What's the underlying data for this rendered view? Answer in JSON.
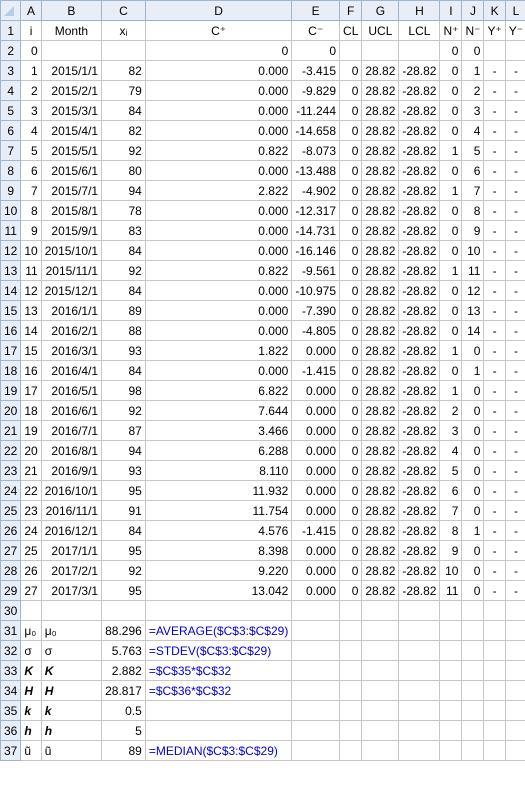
{
  "columns": [
    "A",
    "B",
    "C",
    "D",
    "E",
    "F",
    "G",
    "H",
    "I",
    "J",
    "K",
    "L"
  ],
  "headerRow": {
    "num": "1",
    "cells": {
      "A": "i",
      "B": "Month",
      "C": "xᵢ",
      "D": "C⁺",
      "E": "C⁻",
      "F": "CL",
      "G": "UCL",
      "H": "LCL",
      "I": "N⁺",
      "J": "N⁻",
      "K": "Y⁺",
      "L": "Y⁻"
    }
  },
  "rows": [
    {
      "num": "2",
      "type": "data",
      "cells": {
        "A": "0",
        "D": "0",
        "E": "0",
        "I": "0",
        "J": "0"
      }
    },
    {
      "num": "3",
      "type": "data",
      "cells": {
        "A": "1",
        "B": "2015/1/1",
        "C": "82",
        "D": "0.000",
        "E": "-3.415",
        "F": "0",
        "G": "28.82",
        "H": "-28.82",
        "I": "0",
        "J": "1",
        "K": "-",
        "L": "-"
      }
    },
    {
      "num": "4",
      "type": "data",
      "cells": {
        "A": "2",
        "B": "2015/2/1",
        "C": "79",
        "D": "0.000",
        "E": "-9.829",
        "F": "0",
        "G": "28.82",
        "H": "-28.82",
        "I": "0",
        "J": "2",
        "K": "-",
        "L": "-"
      }
    },
    {
      "num": "5",
      "type": "data",
      "cells": {
        "A": "3",
        "B": "2015/3/1",
        "C": "84",
        "D": "0.000",
        "E": "-11.244",
        "F": "0",
        "G": "28.82",
        "H": "-28.82",
        "I": "0",
        "J": "3",
        "K": "-",
        "L": "-"
      }
    },
    {
      "num": "6",
      "type": "data",
      "cells": {
        "A": "4",
        "B": "2015/4/1",
        "C": "82",
        "D": "0.000",
        "E": "-14.658",
        "F": "0",
        "G": "28.82",
        "H": "-28.82",
        "I": "0",
        "J": "4",
        "K": "-",
        "L": "-"
      }
    },
    {
      "num": "7",
      "type": "data",
      "cells": {
        "A": "5",
        "B": "2015/5/1",
        "C": "92",
        "D": "0.822",
        "E": "-8.073",
        "F": "0",
        "G": "28.82",
        "H": "-28.82",
        "I": "1",
        "J": "5",
        "K": "-",
        "L": "-"
      }
    },
    {
      "num": "8",
      "type": "data",
      "cells": {
        "A": "6",
        "B": "2015/6/1",
        "C": "80",
        "D": "0.000",
        "E": "-13.488",
        "F": "0",
        "G": "28.82",
        "H": "-28.82",
        "I": "0",
        "J": "6",
        "K": "-",
        "L": "-"
      }
    },
    {
      "num": "9",
      "type": "data",
      "cells": {
        "A": "7",
        "B": "2015/7/1",
        "C": "94",
        "D": "2.822",
        "E": "-4.902",
        "F": "0",
        "G": "28.82",
        "H": "-28.82",
        "I": "1",
        "J": "7",
        "K": "-",
        "L": "-"
      }
    },
    {
      "num": "10",
      "type": "data",
      "cells": {
        "A": "8",
        "B": "2015/8/1",
        "C": "78",
        "D": "0.000",
        "E": "-12.317",
        "F": "0",
        "G": "28.82",
        "H": "-28.82",
        "I": "0",
        "J": "8",
        "K": "-",
        "L": "-"
      }
    },
    {
      "num": "11",
      "type": "data",
      "cells": {
        "A": "9",
        "B": "2015/9/1",
        "C": "83",
        "D": "0.000",
        "E": "-14.731",
        "F": "0",
        "G": "28.82",
        "H": "-28.82",
        "I": "0",
        "J": "9",
        "K": "-",
        "L": "-"
      }
    },
    {
      "num": "12",
      "type": "data",
      "cells": {
        "A": "10",
        "B": "2015/10/1",
        "C": "84",
        "D": "0.000",
        "E": "-16.146",
        "F": "0",
        "G": "28.82",
        "H": "-28.82",
        "I": "0",
        "J": "10",
        "K": "-",
        "L": "-"
      }
    },
    {
      "num": "13",
      "type": "data",
      "cells": {
        "A": "11",
        "B": "2015/11/1",
        "C": "92",
        "D": "0.822",
        "E": "-9.561",
        "F": "0",
        "G": "28.82",
        "H": "-28.82",
        "I": "1",
        "J": "11",
        "K": "-",
        "L": "-"
      }
    },
    {
      "num": "14",
      "type": "data",
      "cells": {
        "A": "12",
        "B": "2015/12/1",
        "C": "84",
        "D": "0.000",
        "E": "-10.975",
        "F": "0",
        "G": "28.82",
        "H": "-28.82",
        "I": "0",
        "J": "12",
        "K": "-",
        "L": "-"
      }
    },
    {
      "num": "15",
      "type": "data",
      "cells": {
        "A": "13",
        "B": "2016/1/1",
        "C": "89",
        "D": "0.000",
        "E": "-7.390",
        "F": "0",
        "G": "28.82",
        "H": "-28.82",
        "I": "0",
        "J": "13",
        "K": "-",
        "L": "-"
      }
    },
    {
      "num": "16",
      "type": "data",
      "cells": {
        "A": "14",
        "B": "2016/2/1",
        "C": "88",
        "D": "0.000",
        "E": "-4.805",
        "F": "0",
        "G": "28.82",
        "H": "-28.82",
        "I": "0",
        "J": "14",
        "K": "-",
        "L": "-"
      }
    },
    {
      "num": "17",
      "type": "data",
      "cells": {
        "A": "15",
        "B": "2016/3/1",
        "C": "93",
        "D": "1.822",
        "E": "0.000",
        "F": "0",
        "G": "28.82",
        "H": "-28.82",
        "I": "1",
        "J": "0",
        "K": "-",
        "L": "-"
      }
    },
    {
      "num": "18",
      "type": "data",
      "cells": {
        "A": "16",
        "B": "2016/4/1",
        "C": "84",
        "D": "0.000",
        "E": "-1.415",
        "F": "0",
        "G": "28.82",
        "H": "-28.82",
        "I": "0",
        "J": "1",
        "K": "-",
        "L": "-"
      }
    },
    {
      "num": "19",
      "type": "data",
      "cells": {
        "A": "17",
        "B": "2016/5/1",
        "C": "98",
        "D": "6.822",
        "E": "0.000",
        "F": "0",
        "G": "28.82",
        "H": "-28.82",
        "I": "1",
        "J": "0",
        "K": "-",
        "L": "-"
      }
    },
    {
      "num": "20",
      "type": "data",
      "cells": {
        "A": "18",
        "B": "2016/6/1",
        "C": "92",
        "D": "7.644",
        "E": "0.000",
        "F": "0",
        "G": "28.82",
        "H": "-28.82",
        "I": "2",
        "J": "0",
        "K": "-",
        "L": "-"
      }
    },
    {
      "num": "21",
      "type": "data",
      "cells": {
        "A": "19",
        "B": "2016/7/1",
        "C": "87",
        "D": "3.466",
        "E": "0.000",
        "F": "0",
        "G": "28.82",
        "H": "-28.82",
        "I": "3",
        "J": "0",
        "K": "-",
        "L": "-"
      }
    },
    {
      "num": "22",
      "type": "data",
      "cells": {
        "A": "20",
        "B": "2016/8/1",
        "C": "94",
        "D": "6.288",
        "E": "0.000",
        "F": "0",
        "G": "28.82",
        "H": "-28.82",
        "I": "4",
        "J": "0",
        "K": "-",
        "L": "-"
      }
    },
    {
      "num": "23",
      "type": "data",
      "cells": {
        "A": "21",
        "B": "2016/9/1",
        "C": "93",
        "D": "8.110",
        "E": "0.000",
        "F": "0",
        "G": "28.82",
        "H": "-28.82",
        "I": "5",
        "J": "0",
        "K": "-",
        "L": "-"
      }
    },
    {
      "num": "24",
      "type": "data",
      "cells": {
        "A": "22",
        "B": "2016/10/1",
        "C": "95",
        "D": "11.932",
        "E": "0.000",
        "F": "0",
        "G": "28.82",
        "H": "-28.82",
        "I": "6",
        "J": "0",
        "K": "-",
        "L": "-"
      }
    },
    {
      "num": "25",
      "type": "data",
      "cells": {
        "A": "23",
        "B": "2016/11/1",
        "C": "91",
        "D": "11.754",
        "E": "0.000",
        "F": "0",
        "G": "28.82",
        "H": "-28.82",
        "I": "7",
        "J": "0",
        "K": "-",
        "L": "-"
      }
    },
    {
      "num": "26",
      "type": "data",
      "cells": {
        "A": "24",
        "B": "2016/12/1",
        "C": "84",
        "D": "4.576",
        "E": "-1.415",
        "F": "0",
        "G": "28.82",
        "H": "-28.82",
        "I": "8",
        "J": "1",
        "K": "-",
        "L": "-"
      }
    },
    {
      "num": "27",
      "type": "data",
      "cells": {
        "A": "25",
        "B": "2017/1/1",
        "C": "95",
        "D": "8.398",
        "E": "0.000",
        "F": "0",
        "G": "28.82",
        "H": "-28.82",
        "I": "9",
        "J": "0",
        "K": "-",
        "L": "-"
      }
    },
    {
      "num": "28",
      "type": "data",
      "cells": {
        "A": "26",
        "B": "2017/2/1",
        "C": "92",
        "D": "9.220",
        "E": "0.000",
        "F": "0",
        "G": "28.82",
        "H": "-28.82",
        "I": "10",
        "J": "0",
        "K": "-",
        "L": "-"
      }
    },
    {
      "num": "29",
      "type": "data",
      "cells": {
        "A": "27",
        "B": "2017/3/1",
        "C": "95",
        "D": "13.042",
        "E": "0.000",
        "F": "0",
        "G": "28.82",
        "H": "-28.82",
        "I": "11",
        "J": "0",
        "K": "-",
        "L": "-"
      }
    },
    {
      "num": "30",
      "type": "blank",
      "cells": {}
    },
    {
      "num": "31",
      "type": "formula",
      "cells": {
        "A": "μ₀",
        "B": "μ₀",
        "C": "88.296",
        "D": "=AVERAGE($C$3:$C$29)"
      }
    },
    {
      "num": "32",
      "type": "formula",
      "cells": {
        "A": "σ",
        "B": "σ",
        "C": "5.763",
        "D": "=STDEV($C$3:$C$29)"
      }
    },
    {
      "num": "33",
      "type": "formula",
      "style": "bi",
      "cells": {
        "A": "K",
        "B": "K",
        "C": "2.882",
        "D": "=$C$35*$C$32"
      }
    },
    {
      "num": "34",
      "type": "formula",
      "style": "bi",
      "cells": {
        "A": "H",
        "B": "H",
        "C": "28.817",
        "D": "=$C$36*$C$32"
      }
    },
    {
      "num": "35",
      "type": "formula",
      "style": "bi",
      "cells": {
        "A": "k",
        "B": "k",
        "C": "0.5"
      }
    },
    {
      "num": "36",
      "type": "formula",
      "style": "bi",
      "cells": {
        "A": "h",
        "B": "h",
        "C": "5"
      }
    },
    {
      "num": "37",
      "type": "formula",
      "cells": {
        "A": "ũ",
        "B": "ũ",
        "C": "89",
        "D": "=MEDIAN($C$3:$C$29)"
      }
    }
  ]
}
